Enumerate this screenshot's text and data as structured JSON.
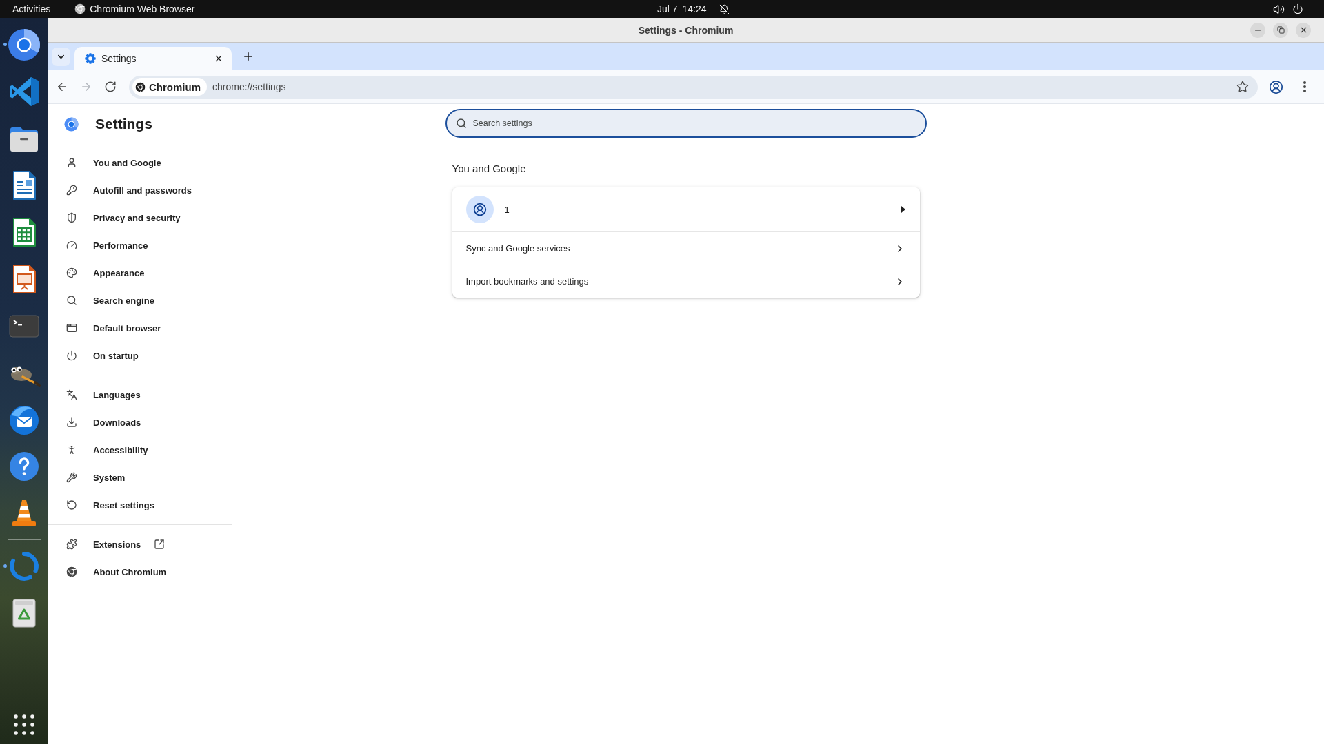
{
  "top_bar": {
    "activities": "Activities",
    "app_name": "Chromium Web Browser",
    "date": "Jul 7",
    "time": "14:24"
  },
  "dock": {
    "pinned": [
      {
        "kind": "browser",
        "running": true
      },
      {
        "kind": "code",
        "running": false
      },
      {
        "kind": "folder",
        "running": false
      },
      {
        "kind": "document",
        "running": false
      },
      {
        "kind": "spreadsheet",
        "running": false
      },
      {
        "kind": "presentation",
        "running": false
      },
      {
        "kind": "terminal",
        "running": false
      },
      {
        "kind": "paint",
        "running": false
      },
      {
        "kind": "mail",
        "running": false
      },
      {
        "kind": "help",
        "running": false
      },
      {
        "kind": "cone",
        "running": false
      }
    ],
    "other": [
      {
        "kind": "sync",
        "running": true
      },
      {
        "kind": "trash",
        "running": false
      }
    ]
  },
  "window": {
    "title": "Settings - Chromium"
  },
  "tabs": [
    {
      "label": "Settings",
      "selected": true
    }
  ],
  "toolbar": {
    "navigation": [
      {
        "kind": "back",
        "disabled": false
      },
      {
        "kind": "forward",
        "disabled": true
      },
      {
        "kind": "reload",
        "disabled": false
      }
    ],
    "site_chip": "Chromium",
    "url": "chrome://settings"
  },
  "sidebar": {
    "title": "Settings",
    "groups": [
      {
        "items": [
          {
            "label": "You and Google",
            "selected": false,
            "external": false
          },
          {
            "label": "Autofill and passwords",
            "selected": false,
            "external": false
          },
          {
            "label": "Privacy and security",
            "selected": false,
            "external": false
          },
          {
            "label": "Performance",
            "selected": false,
            "external": false
          },
          {
            "label": "Appearance",
            "selected": false,
            "external": false
          },
          {
            "label": "Search engine",
            "selected": false,
            "external": false
          },
          {
            "label": "Default browser",
            "selected": false,
            "external": false
          },
          {
            "label": "On startup",
            "selected": false,
            "external": false
          }
        ]
      },
      {
        "items": [
          {
            "label": "Languages",
            "selected": false,
            "external": false
          },
          {
            "label": "Downloads",
            "selected": false,
            "external": false
          },
          {
            "label": "Accessibility",
            "selected": false,
            "external": false
          },
          {
            "label": "System",
            "selected": false,
            "external": false
          },
          {
            "label": "Reset settings",
            "selected": false,
            "external": false
          }
        ]
      },
      {
        "items": [
          {
            "label": "Extensions",
            "selected": false,
            "external": true
          },
          {
            "label": "About Chromium",
            "selected": false,
            "external": false
          }
        ]
      }
    ]
  },
  "search": {
    "placeholder": "Search settings",
    "focused": true
  },
  "section": {
    "heading": "You and Google",
    "rows": [
      {
        "kind": "profile",
        "label": "1"
      },
      {
        "kind": "subpage",
        "label": "Sync and Google services"
      },
      {
        "kind": "subpage",
        "label": "Import bookmarks and settings"
      }
    ]
  }
}
